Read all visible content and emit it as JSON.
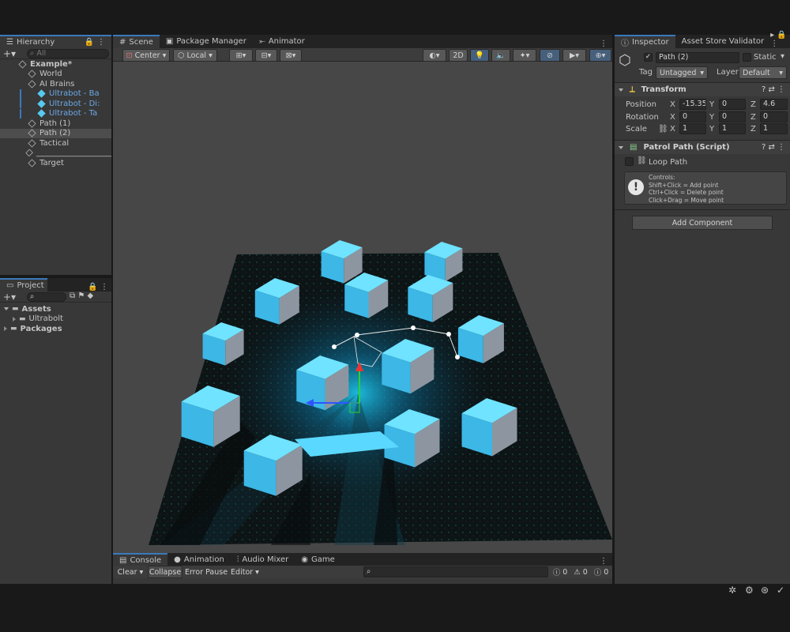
{
  "top_tabs": {
    "hierarchy": "Hierarchy",
    "scene": "Scene",
    "package_manager": "Package Manager",
    "animator": "Animator",
    "inspector": "Inspector",
    "asset_store_validator": "Asset Store Validator"
  },
  "hierarchy": {
    "search_placeholder": "All",
    "items": [
      {
        "label": "Example*",
        "indent": 0,
        "bold": true
      },
      {
        "label": "World",
        "indent": 1
      },
      {
        "label": "AI Brains",
        "indent": 1
      },
      {
        "label": "Ultrabot - Ba",
        "indent": 2,
        "prefab": true
      },
      {
        "label": "Ultrabot - Di:",
        "indent": 2,
        "prefab": true
      },
      {
        "label": "Ultrabot - Ta",
        "indent": 2,
        "prefab": true
      },
      {
        "label": "Path (1)",
        "indent": 1
      },
      {
        "label": "Path (2)",
        "indent": 1,
        "selected": true
      },
      {
        "label": "Tactical",
        "indent": 1
      },
      {
        "label": "___________________",
        "indent": 1
      },
      {
        "label": "Target",
        "indent": 1
      }
    ]
  },
  "project": {
    "tab": "Project",
    "items": [
      {
        "label": "Assets",
        "bold": true
      },
      {
        "label": "Ultrabolt",
        "bold": false
      },
      {
        "label": "Packages",
        "bold": true
      }
    ]
  },
  "scene_toolbar": {
    "pivot": "Center",
    "space": "Local",
    "mode_2d": "2D"
  },
  "inspector": {
    "object_name": "Path (2)",
    "static_label": "Static",
    "tag_label": "Tag",
    "tag_value": "Untagged",
    "layer_label": "Layer",
    "layer_value": "Default",
    "transform": {
      "title": "Transform",
      "position_label": "Position",
      "rotation_label": "Rotation",
      "scale_label": "Scale",
      "position": {
        "x": "-15.35",
        "y": "0",
        "z": "4.6"
      },
      "rotation": {
        "x": "0",
        "y": "0",
        "z": "0"
      },
      "scale": {
        "x": "1",
        "y": "1",
        "z": "1"
      },
      "axis_x": "X",
      "axis_y": "Y",
      "axis_z": "Z"
    },
    "patrol": {
      "title": "Patrol Path (Script)",
      "loop_label": "Loop Path",
      "help_lines": [
        "Controls:",
        "Shift+Click = Add point",
        "Ctrl+Click = Delete point",
        "Click+Drag = Move point"
      ]
    },
    "add_component": "Add Component"
  },
  "console": {
    "tabs": [
      "Console",
      "Animation",
      "Audio Mixer",
      "Game"
    ],
    "clear": "Clear",
    "collapse": "Collapse",
    "error_pause": "Error Pause",
    "editor": "Editor",
    "count_info": "0",
    "count_warn": "0",
    "count_error": "0"
  },
  "colors": {
    "accent": "#3a79bb",
    "cube": "#4cc6ee",
    "glow": "#1fd6ff"
  }
}
